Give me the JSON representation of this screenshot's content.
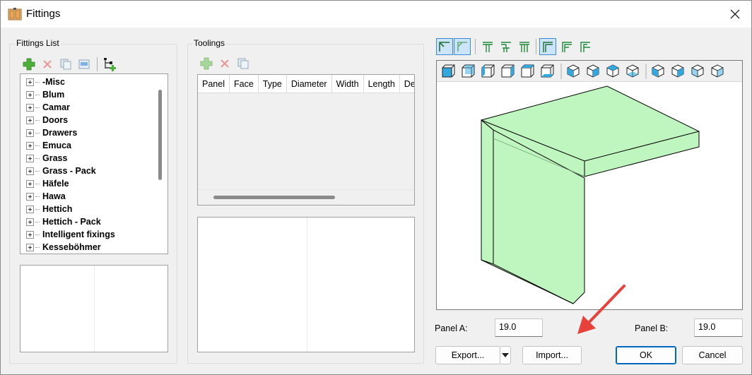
{
  "window": {
    "title": "Fittings",
    "icons": {
      "app": "cabinet-fittings-icon",
      "close": "close-icon"
    }
  },
  "fittings_list": {
    "label": "Fittings List",
    "toolbar": [
      "add-icon",
      "delete-icon",
      "copy-icon",
      "edit-icon",
      "tree-add-icon"
    ],
    "items": [
      "-Misc",
      "Blum",
      "Camar",
      "Doors",
      "Drawers",
      "Emuca",
      "Grass",
      "Grass - Pack",
      "Häfele",
      "Hawa",
      "Hettich",
      "Hettich - Pack",
      "Intelligent fixings",
      "Kesseböhmer"
    ]
  },
  "toolings": {
    "label": "Toolings",
    "toolbar": [
      "add-icon",
      "delete-icon",
      "copy-icon"
    ],
    "columns": [
      "Panel",
      "Face",
      "Type",
      "Diameter",
      "Width",
      "Length",
      "Depth"
    ]
  },
  "preview": {
    "join_types": [
      "corner-join-a-icon",
      "corner-join-b-icon",
      "t-join-a-icon",
      "t-join-b-icon",
      "t-join-c-icon",
      "l-join-a-icon",
      "l-join-b-icon",
      "l-join-c-icon"
    ],
    "view_buttons": [
      "cube-front-icon",
      "cube-back-icon",
      "cube-left-icon",
      "cube-right-icon",
      "cube-top-icon",
      "cube-bottom-icon",
      "iso-1-icon",
      "iso-2-icon",
      "iso-3-icon",
      "iso-4-icon",
      "iso-5-icon",
      "iso-6-icon",
      "iso-7-icon",
      "iso-8-icon"
    ],
    "panel_color": "#bff5bf"
  },
  "panel_a": {
    "label": "Panel A:",
    "value": "19.0"
  },
  "panel_b": {
    "label": "Panel B:",
    "value": "19.0"
  },
  "buttons": {
    "export": "Export...",
    "import": "Import...",
    "ok": "OK",
    "cancel": "Cancel"
  },
  "annotation": {
    "arrow_color": "#e8413b"
  }
}
